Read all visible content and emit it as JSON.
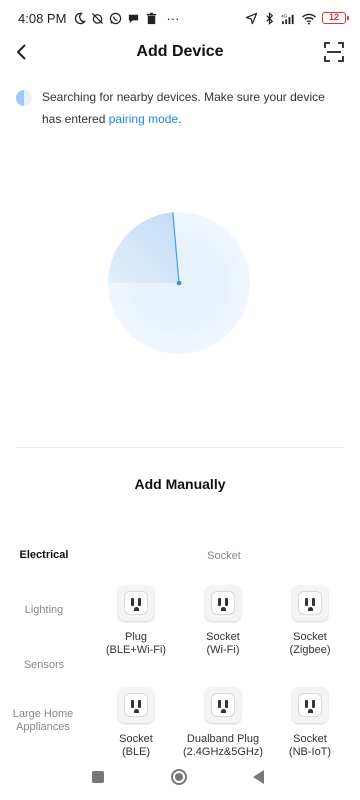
{
  "status_bar": {
    "time": "4:08 PM",
    "more": "···",
    "battery": "12",
    "battery_color": "#d9363e"
  },
  "header": {
    "title": "Add Device",
    "back_icon": "chevron-left-icon",
    "scan_icon": "scan-icon"
  },
  "search": {
    "text": "Searching for nearby devices. Make sure your device has entered ",
    "link": "pairing mode",
    "suffix": ".",
    "accent": "#1e88e5"
  },
  "manual": {
    "title": "Add Manually"
  },
  "categories": [
    {
      "label": "Electrical",
      "active": true
    },
    {
      "label": "Lighting",
      "active": false
    },
    {
      "label": "Sensors",
      "active": false
    },
    {
      "label": "Large Home Appliances",
      "active": false
    }
  ],
  "section_label": "Socket",
  "devices": [
    {
      "name": "Plug",
      "sub": "(BLE+Wi-Fi)"
    },
    {
      "name": "Socket",
      "sub": "(Wi-Fi)"
    },
    {
      "name": "Socket",
      "sub": "(Zigbee)"
    },
    {
      "name": "Socket",
      "sub": "(BLE)"
    },
    {
      "name": "Dualband Plug",
      "sub": "(2.4GHz&5GHz)"
    },
    {
      "name": "Socket",
      "sub": "(NB-IoT)"
    }
  ]
}
